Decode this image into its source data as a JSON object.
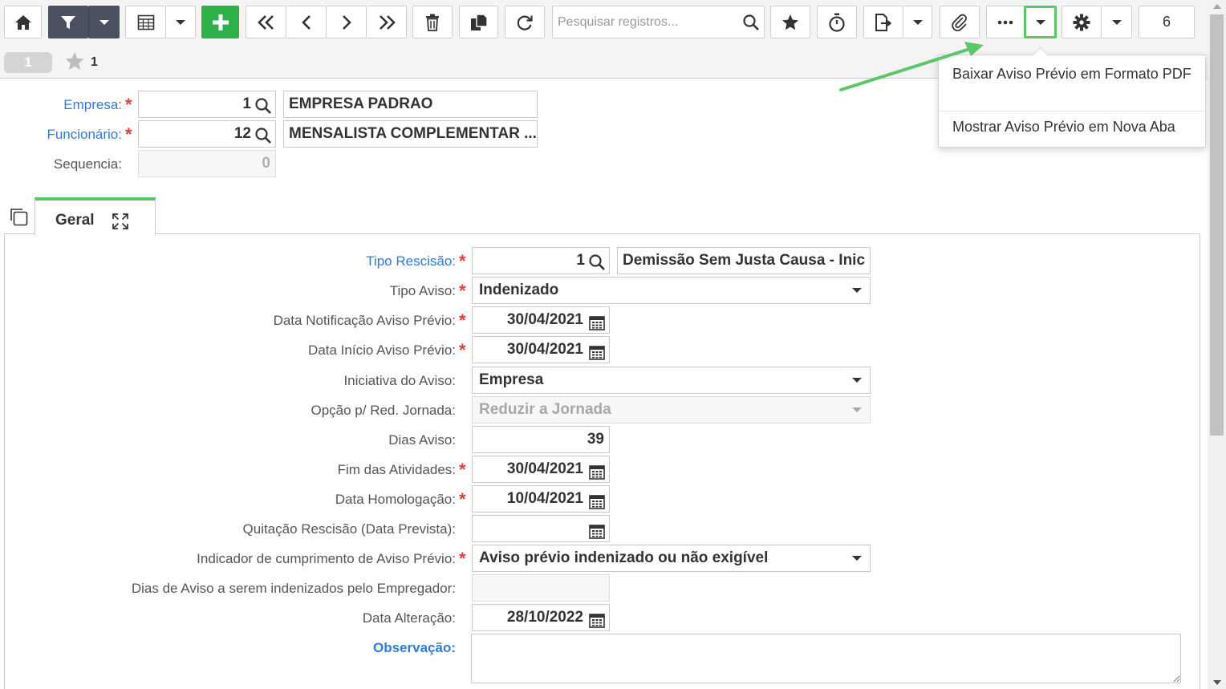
{
  "toolbar": {
    "search_placeholder": "Pesquisar registros...",
    "record_counter": "6",
    "highlight_color": "#5cc768",
    "add_color": "#2fb14a",
    "filter_color": "#4a5160",
    "icons": [
      "home-icon",
      "filter-icon",
      "grid-icon",
      "plus-icon",
      "first-icon",
      "prev-icon",
      "next-icon",
      "last-icon",
      "trash-icon",
      "copy-icon",
      "refresh-icon",
      "search-icon",
      "star-icon",
      "stopwatch-icon",
      "export-icon",
      "paperclip-icon",
      "more-icon",
      "chevron-down-icon",
      "gear-icon"
    ]
  },
  "subbar": {
    "page": "1",
    "favorites_count": "1"
  },
  "header_form": {
    "empresa": {
      "label": "Empresa:",
      "code": "1",
      "name": "EMPRESA PADRAO"
    },
    "funcionario": {
      "label": "Funcionário:",
      "code": "12",
      "name": "MENSALISTA COMPLEMENTAR ..."
    },
    "sequencia": {
      "label": "Sequencia:",
      "value": "0"
    }
  },
  "tab": {
    "label": "Geral"
  },
  "form": {
    "tipo_rescisao": {
      "label": "Tipo Rescisão:",
      "code": "1",
      "name": "Demissão Sem Justa Causa - Inic"
    },
    "tipo_aviso": {
      "label": "Tipo Aviso:",
      "value": "Indenizado"
    },
    "data_notificacao": {
      "label": "Data Notificação Aviso Prévio:",
      "value": "30/04/2021"
    },
    "data_inicio": {
      "label": "Data Início Aviso Prévio:",
      "value": "30/04/2021"
    },
    "iniciativa": {
      "label": "Iniciativa do Aviso:",
      "value": "Empresa"
    },
    "opcao_red": {
      "label": "Opção p/ Red. Jornada:",
      "value": "Reduzir a Jornada"
    },
    "dias_aviso": {
      "label": "Dias Aviso:",
      "value": "39"
    },
    "fim_atividades": {
      "label": "Fim das Atividades:",
      "value": "30/04/2021"
    },
    "data_homologacao": {
      "label": "Data Homologação:",
      "value": "10/04/2021"
    },
    "quitacao": {
      "label": "Quitação Rescisão (Data Prevista):",
      "value": ""
    },
    "indicador": {
      "label": "Indicador de cumprimento de Aviso Prévio:",
      "value": "Aviso prévio indenizado ou não exigível"
    },
    "dias_indenizados": {
      "label": "Dias de Aviso a serem indenizados pelo Empregador:",
      "value": ""
    },
    "data_alteracao": {
      "label": "Data Alteração:",
      "value": "28/10/2022"
    },
    "observacao": {
      "label": "Observação:",
      "value": ""
    }
  },
  "dropdown_menu": {
    "items": [
      "Baixar Aviso Prévio em Formato PDF",
      "Mostrar Aviso Prévio em Nova Aba"
    ]
  }
}
